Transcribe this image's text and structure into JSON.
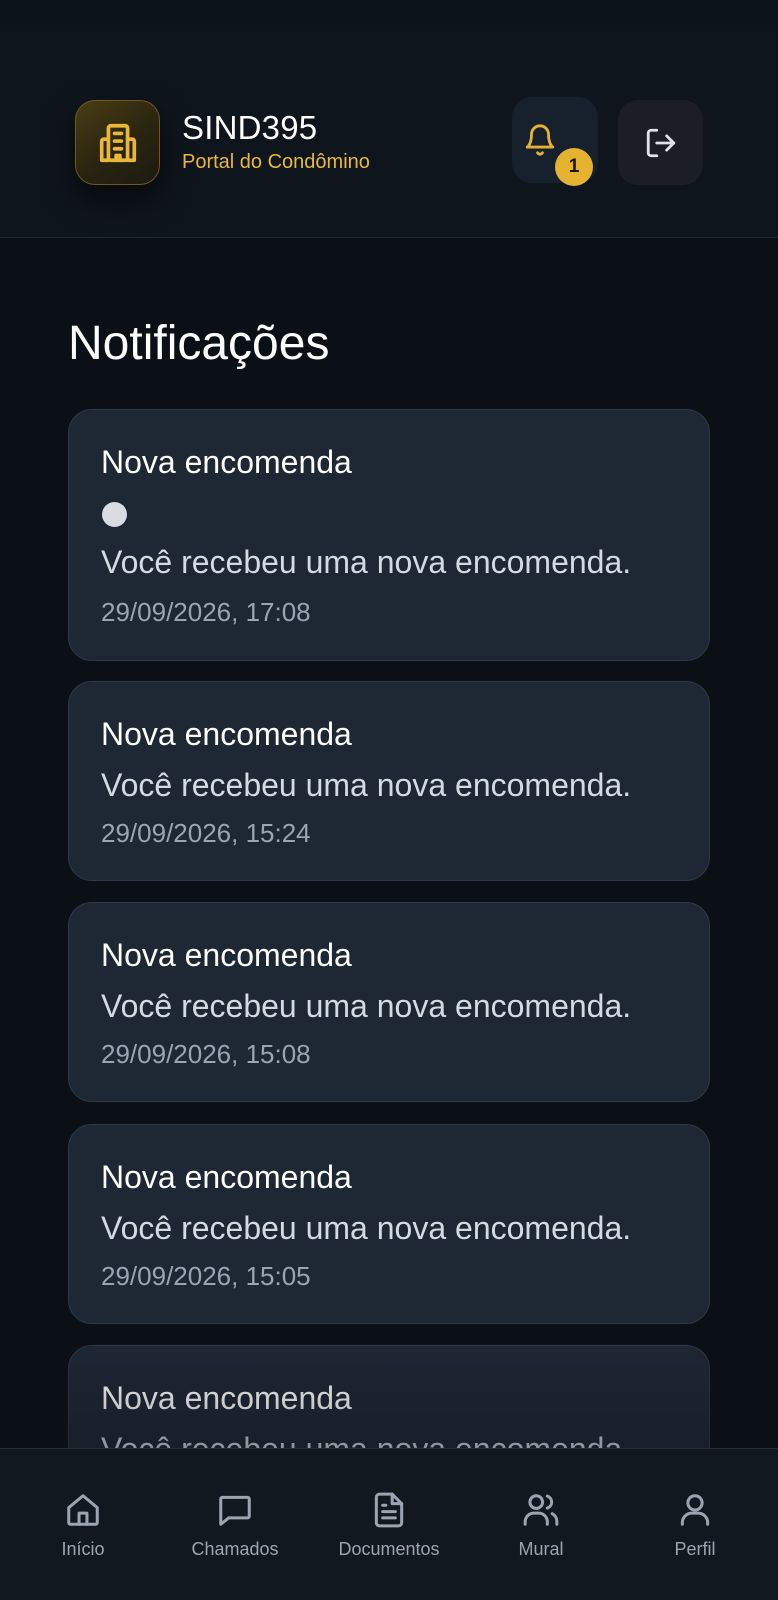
{
  "header": {
    "title": "SIND395",
    "subtitle": "Portal do Condômino",
    "notification_count": "1",
    "logo_icon": "building-icon",
    "bell_icon": "bell-icon",
    "logout_icon": "logout-icon"
  },
  "page": {
    "title": "Notificações"
  },
  "notifications": [
    {
      "title": "Nova encomenda",
      "message": "Você recebeu uma nova encomenda.",
      "time": "29/09/2026, 17:08",
      "unread": true
    },
    {
      "title": "Nova encomenda",
      "message": "Você recebeu uma nova encomenda.",
      "time": "29/09/2026, 15:24",
      "unread": false
    },
    {
      "title": "Nova encomenda",
      "message": "Você recebeu uma nova encomenda.",
      "time": "29/09/2026, 15:08",
      "unread": false
    },
    {
      "title": "Nova encomenda",
      "message": "Você recebeu uma nova encomenda.",
      "time": "29/09/2026, 15:05",
      "unread": false
    },
    {
      "title": "Nova encomenda",
      "message": "Você recebeu uma nova encomenda.",
      "time": "",
      "unread": false
    }
  ],
  "nav": {
    "items": [
      {
        "label": "Início",
        "icon": "home-icon"
      },
      {
        "label": "Chamados",
        "icon": "chat-icon"
      },
      {
        "label": "Documentos",
        "icon": "document-icon"
      },
      {
        "label": "Mural",
        "icon": "users-icon"
      },
      {
        "label": "Perfil",
        "icon": "user-icon"
      }
    ]
  },
  "colors": {
    "accent": "#e5b331",
    "background": "#0b1017",
    "card": "#1e2734"
  }
}
